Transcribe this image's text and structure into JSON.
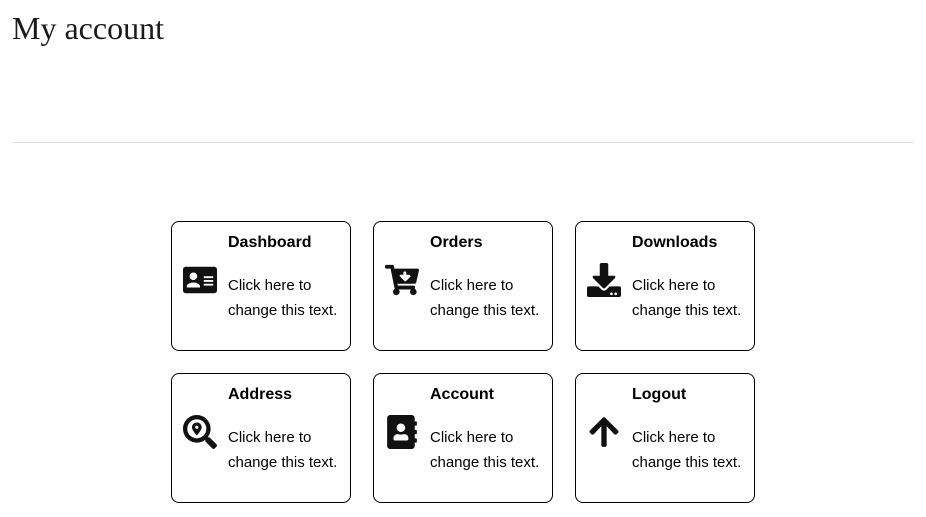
{
  "page": {
    "title": "My account"
  },
  "cards": [
    {
      "title": "Dashboard",
      "desc": "Click here to change this text."
    },
    {
      "title": "Orders",
      "desc": "Click here to change this text."
    },
    {
      "title": "Downloads",
      "desc": "Click here to change this text."
    },
    {
      "title": "Address",
      "desc": "Click here to change this text."
    },
    {
      "title": "Account",
      "desc": "Click here to change this text."
    },
    {
      "title": "Logout",
      "desc": "Click here to change this text."
    }
  ]
}
